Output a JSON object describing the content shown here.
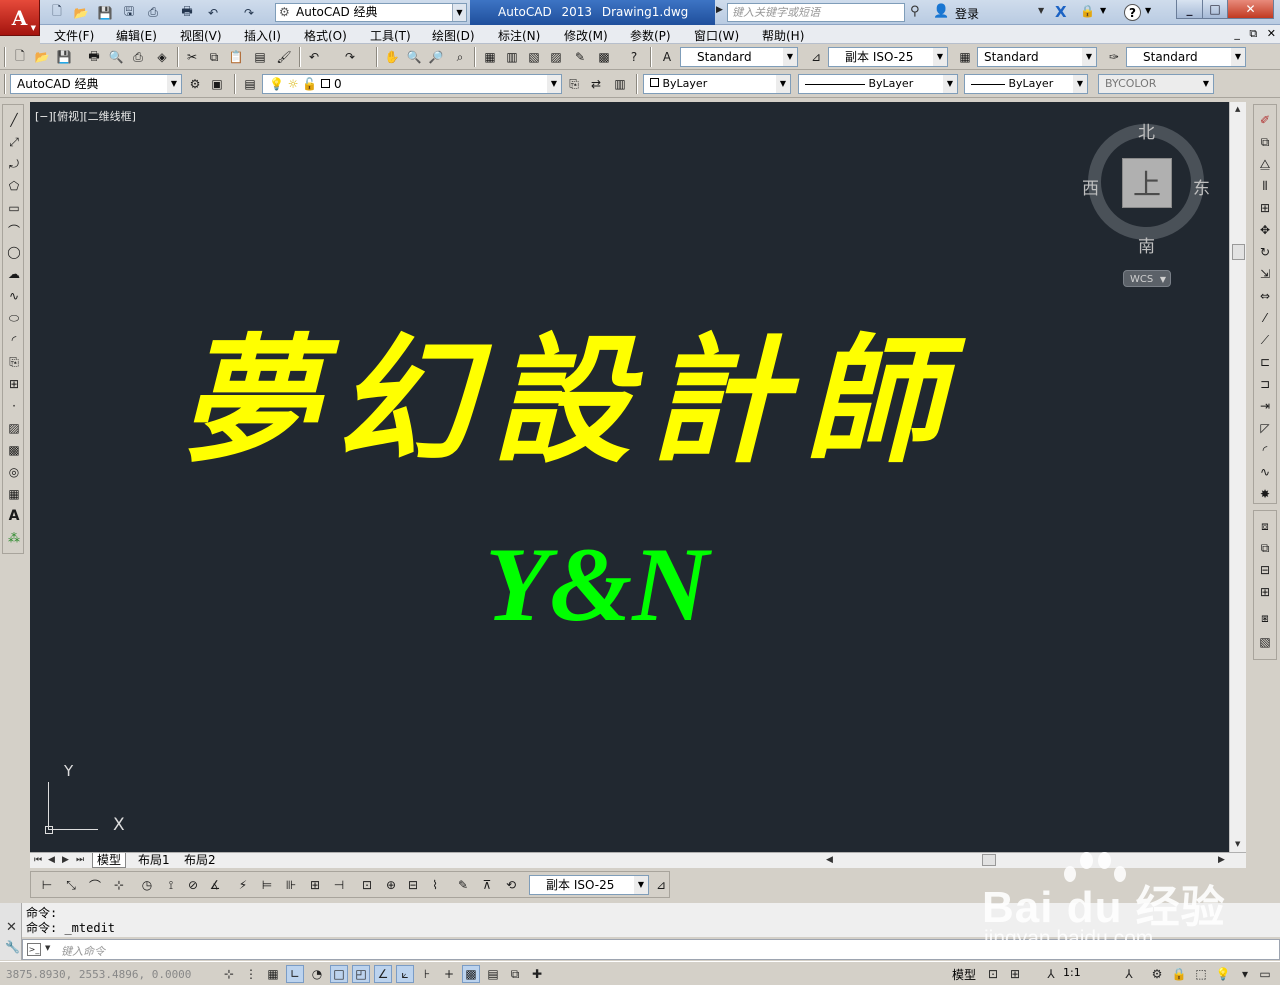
{
  "titlebar": {
    "logo_letter": "A",
    "workspace": "AutoCAD 经典",
    "app_title": "AutoCAD 2013    Drawing1.dwg",
    "search_placeholder": "键入关键字或短语",
    "login_label": "登录",
    "help_label": "?"
  },
  "menu": {
    "items": [
      "文件(F)",
      "编辑(E)",
      "视图(V)",
      "插入(I)",
      "格式(O)",
      "工具(T)",
      "绘图(D)",
      "标注(N)",
      "修改(M)",
      "参数(P)",
      "窗口(W)",
      "帮助(H)"
    ],
    "doc_controls": "_ ⧉ ✕"
  },
  "toolbar1": {
    "text_style": "Standard",
    "dim_style": "副本 ISO-25",
    "table_style": "Standard",
    "multileader_style": "Standard"
  },
  "toolbar2": {
    "workspace": "AutoCAD 经典",
    "layer": "0",
    "color": "ByLayer",
    "linetype": "ByLayer",
    "lineweight": "ByLayer",
    "plot_style": "BYCOLOR"
  },
  "canvas": {
    "viewport_label": "[−][俯视][二维线框]",
    "main_text": "夢幻設計師",
    "sub_text": "Y&N",
    "main_color": "#ffff00",
    "sub_color": "#00ff00",
    "background": "#212830"
  },
  "viewcube": {
    "north": "北",
    "south": "南",
    "east": "东",
    "west": "西",
    "face": "上",
    "wcs": "WCS"
  },
  "ucs": {
    "x": "X",
    "y": "Y"
  },
  "layout_tabs": [
    "模型",
    "布局1",
    "布局2"
  ],
  "dim_toolbar": {
    "dim_style": "副本 ISO-25"
  },
  "command": {
    "history": [
      "命令:",
      "命令: _mtedit"
    ],
    "placeholder": "键入命令"
  },
  "status": {
    "coords": "3875.8930, 2553.4896, 0.0000",
    "model_label": "模型",
    "scale": "1:1"
  },
  "watermark": {
    "brand": "Bai du 经验",
    "url": "jingyan.baidu.com"
  }
}
